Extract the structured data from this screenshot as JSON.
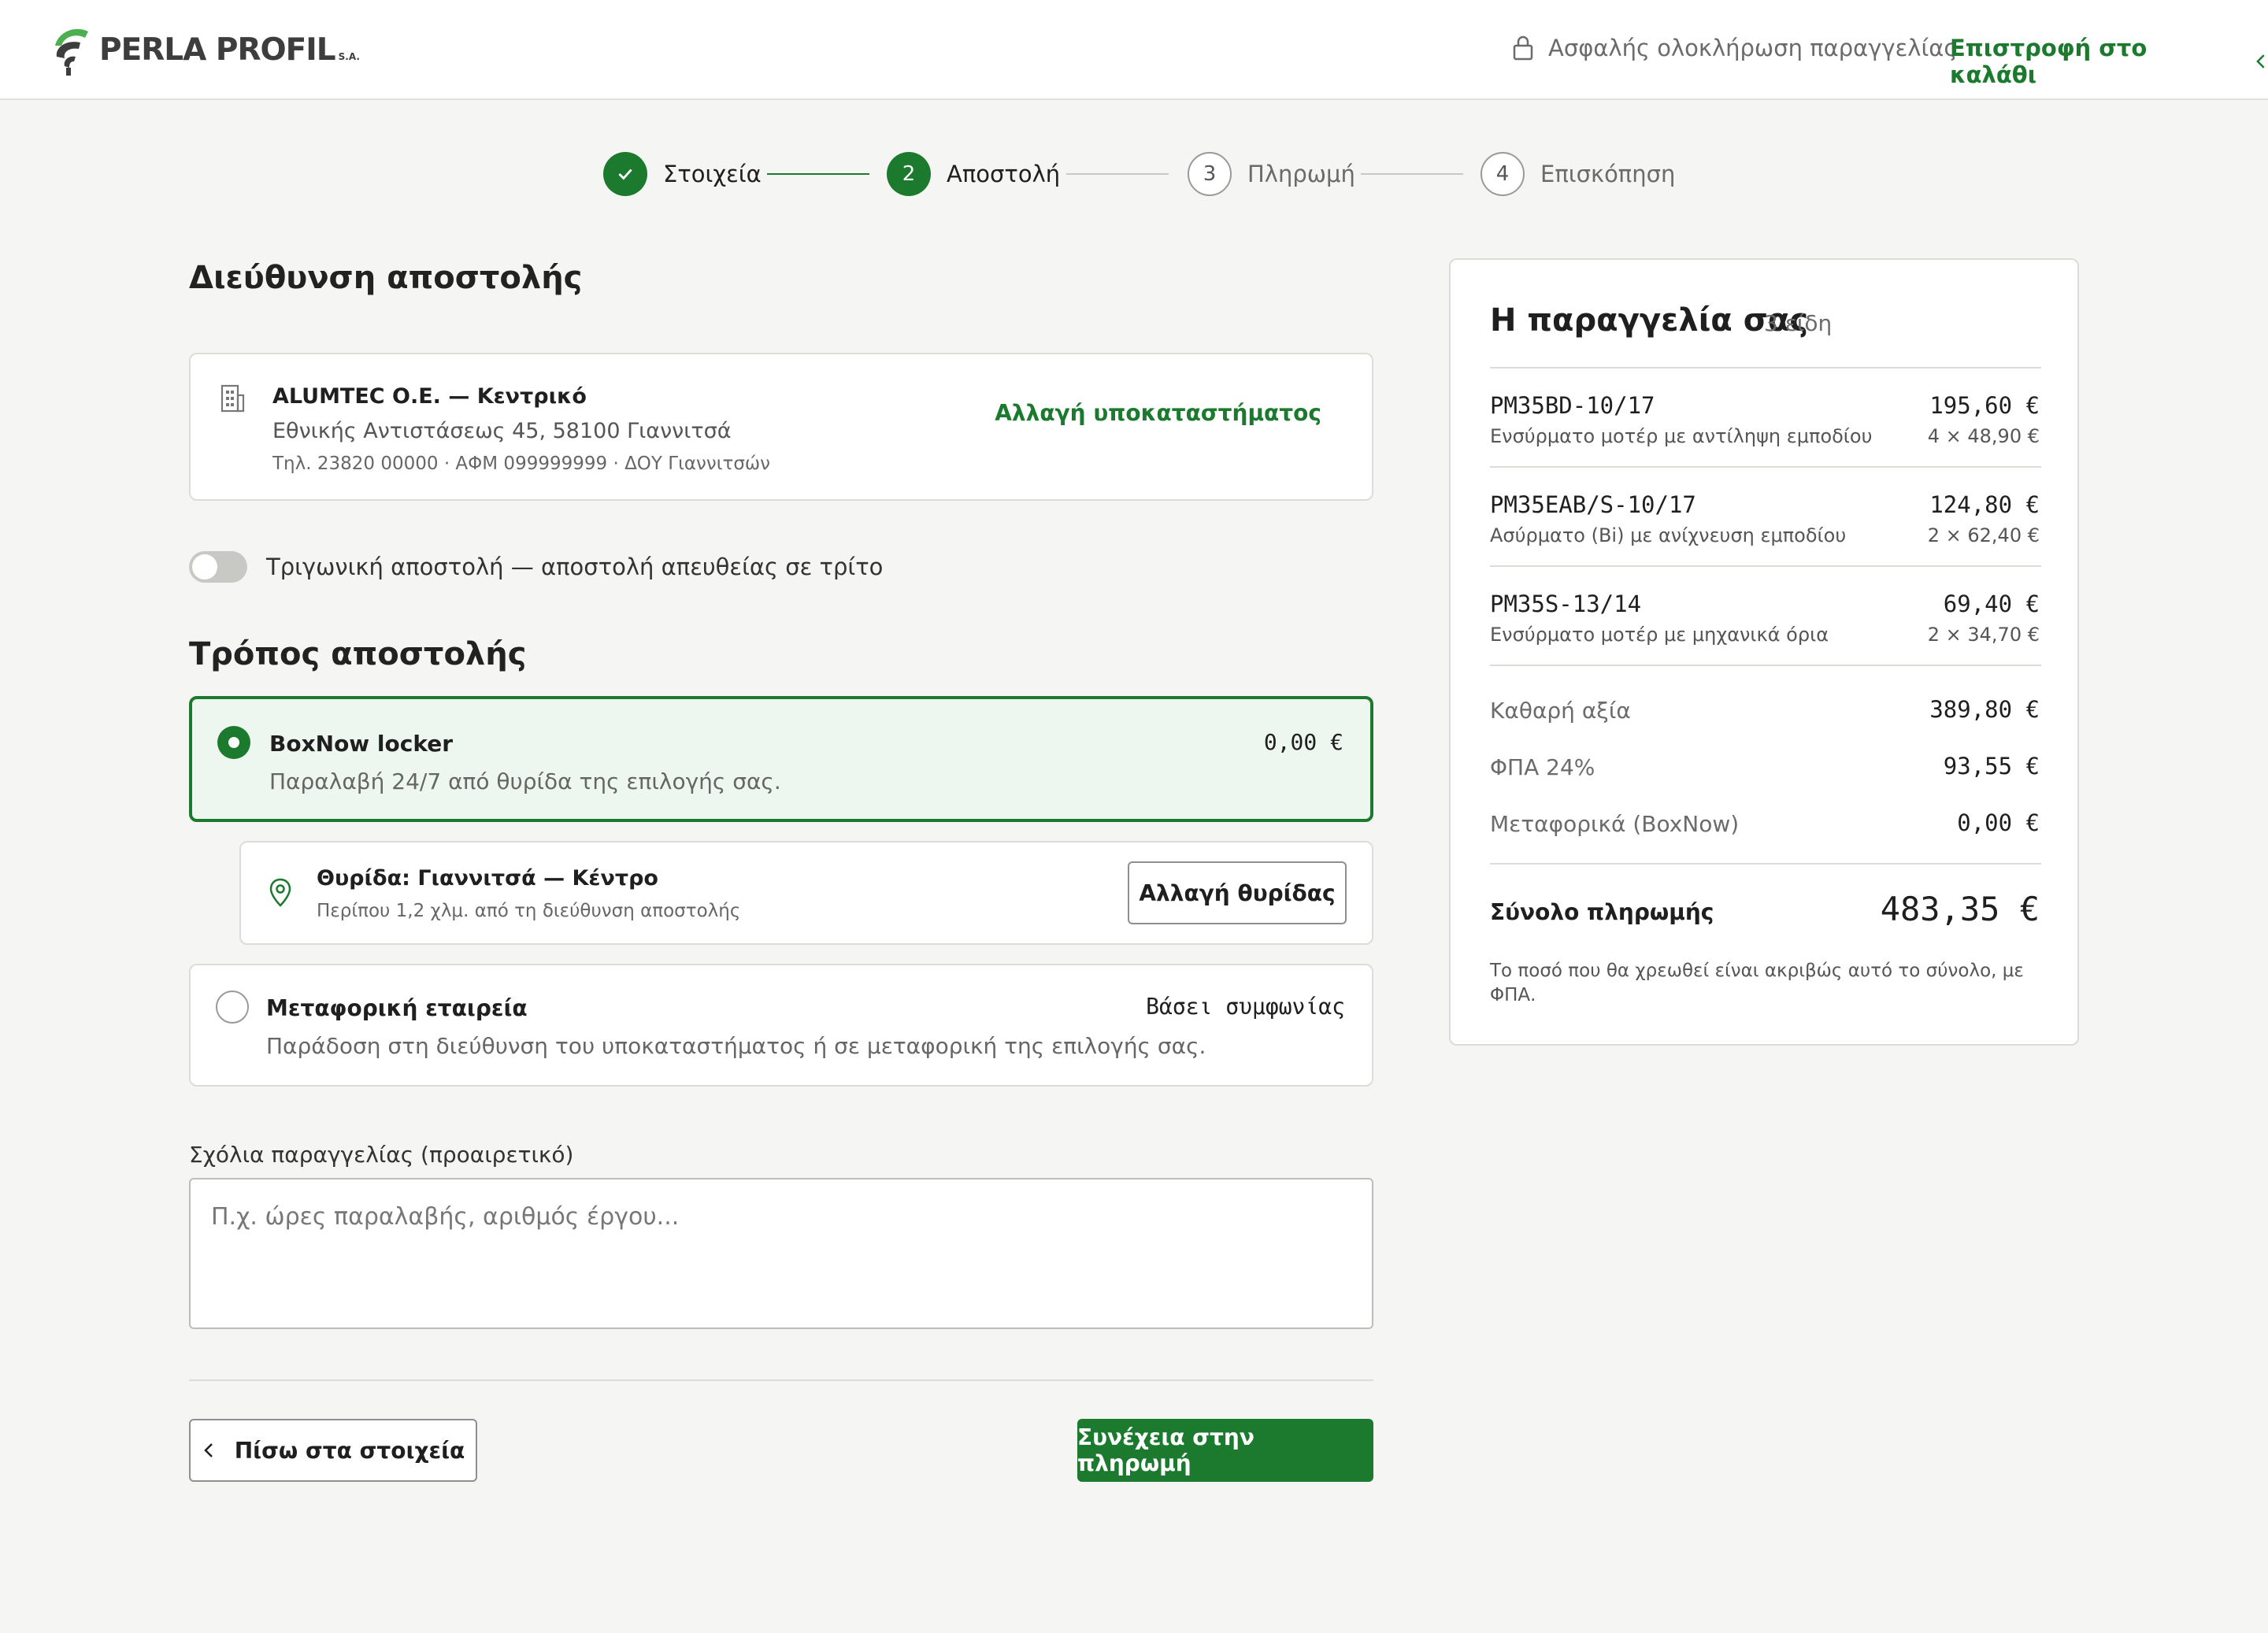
{
  "brand": {
    "name": "PERLA PROFIL",
    "suffix": "S.A.",
    "accent": "#1b7a2e"
  },
  "header": {
    "secure_text": "Ασφαλής ολοκλήρωση παραγγελίας",
    "back_to_cart": "Επιστροφή στο καλάθι"
  },
  "steps": [
    {
      "number": "✓",
      "label": "Στοιχεία",
      "state": "done"
    },
    {
      "number": "2",
      "label": "Αποστολή",
      "state": "active"
    },
    {
      "number": "3",
      "label": "Πληρωμή",
      "state": "upcoming"
    },
    {
      "number": "4",
      "label": "Επισκόπηση",
      "state": "upcoming"
    }
  ],
  "shipping_address": {
    "heading": "Διεύθυνση αποστολής",
    "name": "ALUMTEC Ο.Ε. — Κεντρικό",
    "street": "Εθνικής Αντιστάσεως 45, 58100 Γιαννιτσά",
    "meta": "Τηλ. 23820 00000 · ΑΦΜ 099999999 · ΔΟΥ Γιαννιτσών",
    "change_label": "Αλλαγή υποκαταστήματος"
  },
  "triangular": {
    "label": "Τριγωνική αποστολή — αποστολή απευθείας σε τρίτο",
    "enabled": false
  },
  "shipping_method": {
    "heading": "Τρόπος αποστολής",
    "options": [
      {
        "title": "BoxNow locker",
        "description": "Παραλαβή 24/7 από θυρίδα της επιλογής σας.",
        "price": "0,00 €",
        "selected": true
      },
      {
        "title": "Μεταφορική εταιρεία",
        "description": "Παράδοση στη διεύθυνση του υποκαταστήματος ή σε μεταφορική της επιλογής σας.",
        "price": "Βάσει συμφωνίας",
        "selected": false
      }
    ],
    "locker": {
      "title": "Θυρίδα: Γιαννιτσά — Κέντρο",
      "distance": "Περίπου 1,2 χλμ. από τη διεύθυνση αποστολής",
      "change_label": "Αλλαγή θυρίδας"
    }
  },
  "comments": {
    "label": "Σχόλια παραγγελίας (προαιρετικό)",
    "placeholder": "Π.χ. ώρες παραλαβής, αριθμός έργου...",
    "value": ""
  },
  "actions": {
    "back": "Πίσω στα στοιχεία",
    "continue": "Συνέχεια στην πληρωμή"
  },
  "summary": {
    "title": "Η παραγγελία σας",
    "count": "3 είδη",
    "items": [
      {
        "code": "PM35BD-10/17",
        "description": "Ενσύρματο μοτέρ με αντίληψη εμποδίου",
        "price": "195,60 €",
        "qty": "4 × 48,90 €"
      },
      {
        "code": "PM35EAB/S-10/17",
        "description": "Ασύρματο (Bi) με ανίχνευση εμποδίου",
        "price": "124,80 €",
        "qty": "2 × 62,40 €"
      },
      {
        "code": "PM35S-13/14",
        "description": "Ενσύρματο μοτέρ με μηχανικά όρια",
        "price": "69,40 €",
        "qty": "2 × 34,70 €"
      }
    ],
    "totals": [
      {
        "label": "Καθαρή αξία",
        "value": "389,80 €"
      },
      {
        "label": "ΦΠΑ 24%",
        "value": "93,55 €"
      },
      {
        "label": "Μεταφορικά (BoxNow)",
        "value": "0,00 €"
      }
    ],
    "grand_total": {
      "label": "Σύνολο πληρωμής",
      "value": "483,35 €"
    },
    "note": "Το ποσό που θα χρεωθεί είναι ακριβώς αυτό το σύνολο, με ΦΠΑ."
  }
}
